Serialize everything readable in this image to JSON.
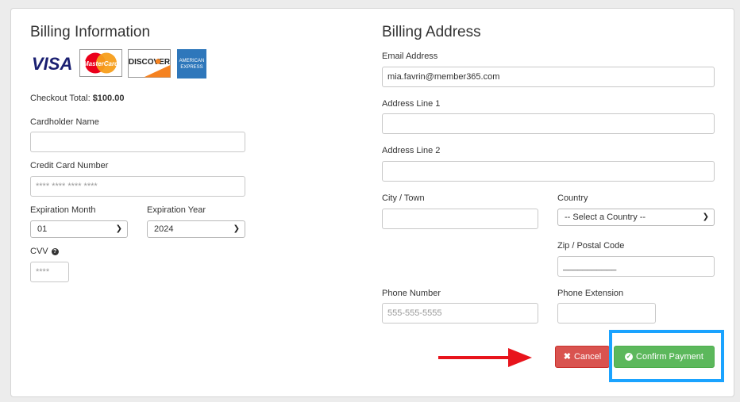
{
  "billing_info": {
    "title": "Billing Information",
    "card_logos": [
      "visa-logo",
      "mastercard-logo",
      "discover-logo",
      "amex-logo"
    ],
    "checkout_total_label": "Checkout Total:",
    "checkout_total_value": "$100.00",
    "cardholder_name_label": "Cardholder Name",
    "cardholder_name_value": "",
    "cc_number_label": "Credit Card Number",
    "cc_number_placeholder": "**** **** **** ****",
    "exp_month_label": "Expiration Month",
    "exp_month_value": "01",
    "exp_year_label": "Expiration Year",
    "exp_year_value": "2024",
    "cvv_label": "CVV",
    "cvv_placeholder": "****"
  },
  "billing_address": {
    "title": "Billing Address",
    "email_label": "Email Address",
    "email_value": "mia.favrin@member365.com",
    "address1_label": "Address Line 1",
    "address1_value": "",
    "address2_label": "Address Line 2",
    "address2_value": "",
    "city_label": "City / Town",
    "city_value": "",
    "country_label": "Country",
    "country_value": "-- Select a Country --",
    "zip_label": "Zip / Postal Code",
    "zip_value": "___________",
    "phone_label": "Phone Number",
    "phone_placeholder": "555-555-5555",
    "phone_ext_label": "Phone Extension",
    "phone_ext_value": ""
  },
  "actions": {
    "cancel_label": "Cancel",
    "confirm_label": "Confirm Payment"
  },
  "colors": {
    "cancel": "#d9534f",
    "confirm": "#5cb85c",
    "highlight": "#1aa3ff",
    "arrow": "#e8141c"
  }
}
